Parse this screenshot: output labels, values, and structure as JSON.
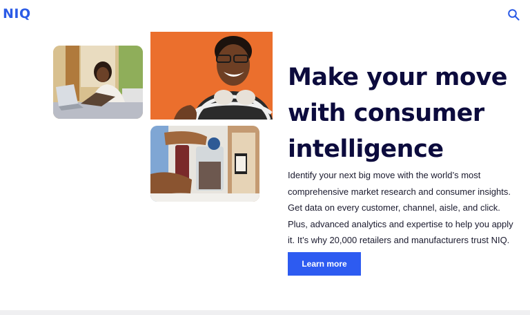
{
  "header": {
    "logo": "NIQ",
    "search_icon": "search-icon"
  },
  "hero": {
    "headline": "Make your move with consumer intelligence",
    "body": "Identify your next big move with the world’s most comprehensive market research and consumer insights. Get data on every customer, channel, aisle, and click. Plus, advanced analytics and expertise to help you apply it. It’s why 20,000 retailers and manufacturers trust NIQ.",
    "cta_label": "Learn more"
  },
  "colors": {
    "brand": "#2b5be6",
    "cta": "#2d5bf1",
    "headline": "#0c0b3d",
    "photo_orange": "#e8692a"
  }
}
